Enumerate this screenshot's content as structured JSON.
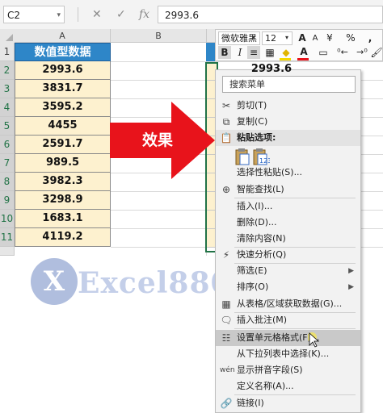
{
  "formula_bar": {
    "name_box": "C2",
    "cancel_icon": "✕",
    "enter_icon": "✓",
    "fx_label": "fx",
    "formula_value": "2993.6"
  },
  "columns": [
    {
      "label": "A"
    },
    {
      "label": "B"
    }
  ],
  "rows": [
    "1",
    "2",
    "3",
    "4",
    "5",
    "6",
    "7",
    "8",
    "9",
    "10",
    "11"
  ],
  "table": {
    "header": "数值型数据",
    "values": [
      "2993.6",
      "3831.7",
      "3595.2",
      "4455",
      "2591.7",
      "989.5",
      "3982.3",
      "3298.9",
      "1683.1",
      "4119.2"
    ]
  },
  "arrow_label": "效果",
  "column_d": {
    "first_value": "2993.6"
  },
  "watermark": {
    "logo_text": "X",
    "text": "Excel880工作室"
  },
  "mini_toolbar": {
    "font_name": "微软雅黑",
    "font_size": "12",
    "grow_font": "A",
    "shrink_font": "A",
    "currency": "¥",
    "percent": "%",
    "comma": ",",
    "bold": "B",
    "italic": "I",
    "font_color": "A"
  },
  "context_menu": {
    "search_placeholder": "搜索菜单",
    "items": [
      {
        "label": "剪切(T)",
        "icon": "scissors-icon"
      },
      {
        "label": "复制(C)",
        "icon": "copy-icon"
      },
      {
        "label": "粘贴选项:",
        "icon": "paste-icon"
      },
      {
        "label": "选择性粘贴(S)...",
        "icon": ""
      },
      {
        "label": "智能查找(L)",
        "icon": "smart-lookup-icon"
      },
      {
        "label": "插入(I)...",
        "icon": ""
      },
      {
        "label": "删除(D)...",
        "icon": ""
      },
      {
        "label": "清除内容(N)",
        "icon": ""
      },
      {
        "label": "快速分析(Q)",
        "icon": "quick-analysis-icon"
      },
      {
        "label": "筛选(E)",
        "icon": "",
        "submenu": true
      },
      {
        "label": "排序(O)",
        "icon": "",
        "submenu": true
      },
      {
        "label": "从表格/区域获取数据(G)...",
        "icon": "table-icon"
      },
      {
        "label": "插入批注(M)",
        "icon": "comment-icon"
      },
      {
        "label": "设置单元格格式(F)...",
        "icon": "format-cells-icon",
        "highlighted": true
      },
      {
        "label": "从下拉列表中选择(K)...",
        "icon": ""
      },
      {
        "label": "显示拼音字段(S)",
        "icon": "phonetic-icon"
      },
      {
        "label": "定义名称(A)...",
        "icon": ""
      },
      {
        "label": "链接(I)",
        "icon": "link-icon"
      }
    ]
  },
  "colors": {
    "header_blue": "#2e86c8",
    "value_fill": "#fdf1cf",
    "arrow_red": "#e8131b",
    "selection_green": "#217346",
    "menu_highlight": "#c9c9c9"
  }
}
